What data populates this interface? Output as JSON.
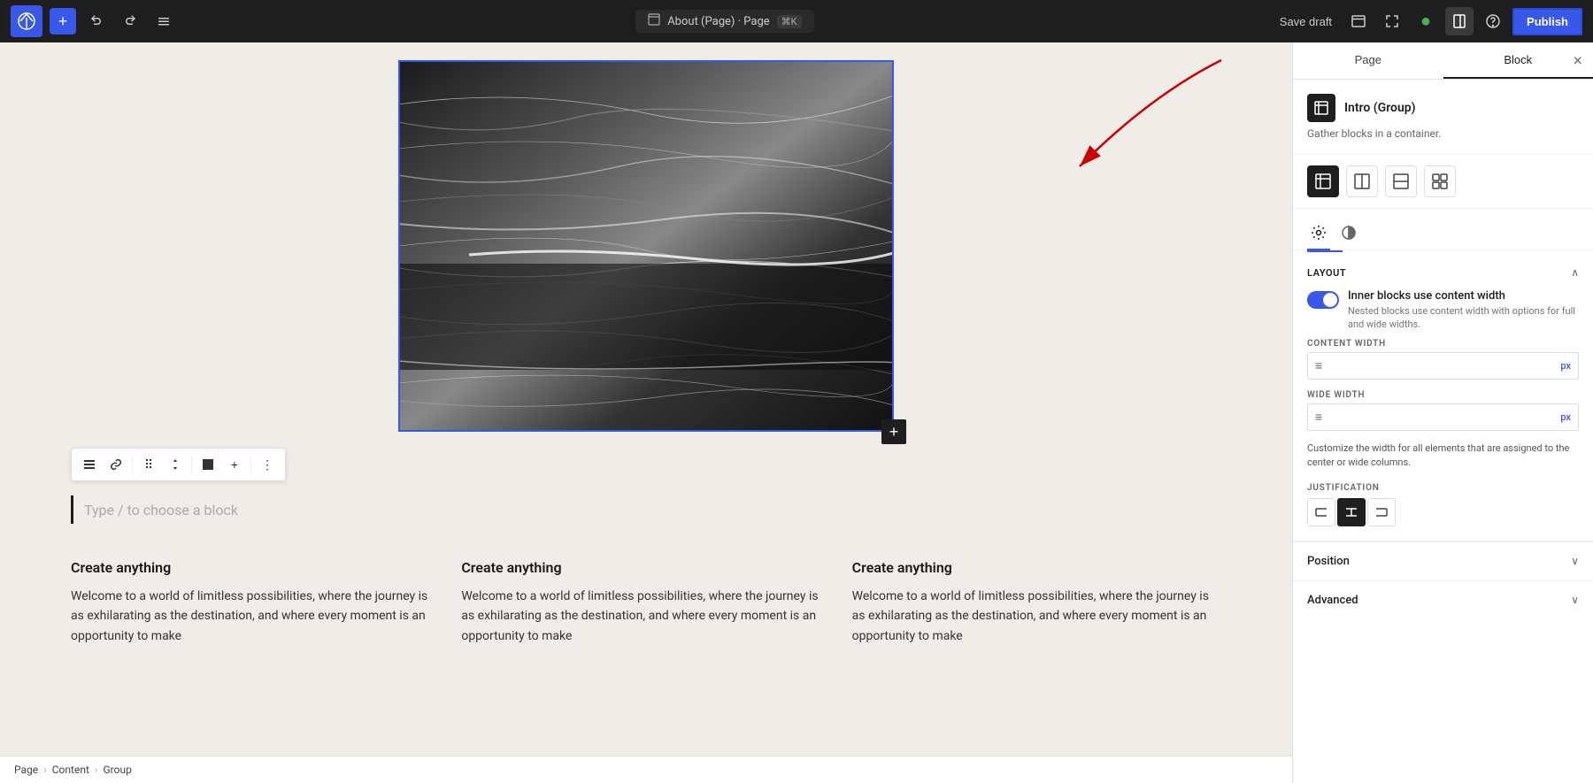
{
  "topbar": {
    "wp_logo": "W",
    "add_label": "+",
    "undo_label": "↩",
    "redo_label": "↪",
    "menu_label": "☰",
    "page_info": {
      "icon": "⊞",
      "title": "About (Page) · Page",
      "shortcut": "⌘K"
    },
    "save_draft_label": "Save draft",
    "view_icon": "⊡",
    "fullscreen_icon": "⤢",
    "green_icon": "●",
    "settings_icon": "⊟",
    "help_icon": "?",
    "publish_label": "Publish"
  },
  "sidebar": {
    "tab_page": "Page",
    "tab_block": "Block",
    "close_icon": "×",
    "block_icon": "⊞",
    "block_title": "Intro (Group)",
    "block_desc": "Gather blocks in a container.",
    "styles": [
      {
        "icon": "⊞",
        "active": true
      },
      {
        "icon": "⊡",
        "active": false
      },
      {
        "icon": "⊟",
        "active": false
      },
      {
        "icon": "⊞",
        "active": false
      }
    ],
    "settings_icon": "⚙",
    "contrast_icon": "◑",
    "layout_title": "Layout",
    "toggle_label": "Inner blocks use content width",
    "toggle_sublabel": "Nested blocks use content width with options for full and wide widths.",
    "content_width_label": "CONTENT WIDTH",
    "content_width_icon": "≡",
    "content_width_value": "",
    "content_width_suffix": "px",
    "wide_width_label": "WIDE WIDTH",
    "wide_width_icon": "≡",
    "wide_width_value": "",
    "wide_width_suffix": "px",
    "customize_text": "Customize the width for all elements that are assigned to the center or wide columns.",
    "justification_label": "JUSTIFICATION",
    "just_left": "⊣",
    "just_center": "+",
    "just_right": "⊢",
    "position_label": "Position",
    "advanced_label": "Advanced"
  },
  "canvas": {
    "paragraph_placeholder": "Type / to choose a block",
    "columns": [
      {
        "title": "Create anything",
        "text": "Welcome to a world of limitless possibilities, where the journey is as exhilarating as the destination, and where every moment is an opportunity to make"
      },
      {
        "title": "Create anything",
        "text": "Welcome to a world of limitless possibilities, where the journey is as exhilarating as the destination, and where every moment is an opportunity to make"
      },
      {
        "title": "Create anything",
        "text": "Welcome to a world of limitless possibilities, where the journey is as exhilarating as the destination, and where every moment is an opportunity to make"
      }
    ]
  },
  "breadcrumb": {
    "items": [
      "Page",
      "Content",
      "Group"
    ]
  },
  "toolbar": {
    "list_icon": "≡",
    "link_icon": "⊕",
    "drag_icon": "⠿",
    "move_icon": "⌃",
    "square_icon": "■",
    "add_icon": "+",
    "more_icon": "⋮"
  },
  "annotation": {
    "arrow_color": "#cc0000"
  }
}
